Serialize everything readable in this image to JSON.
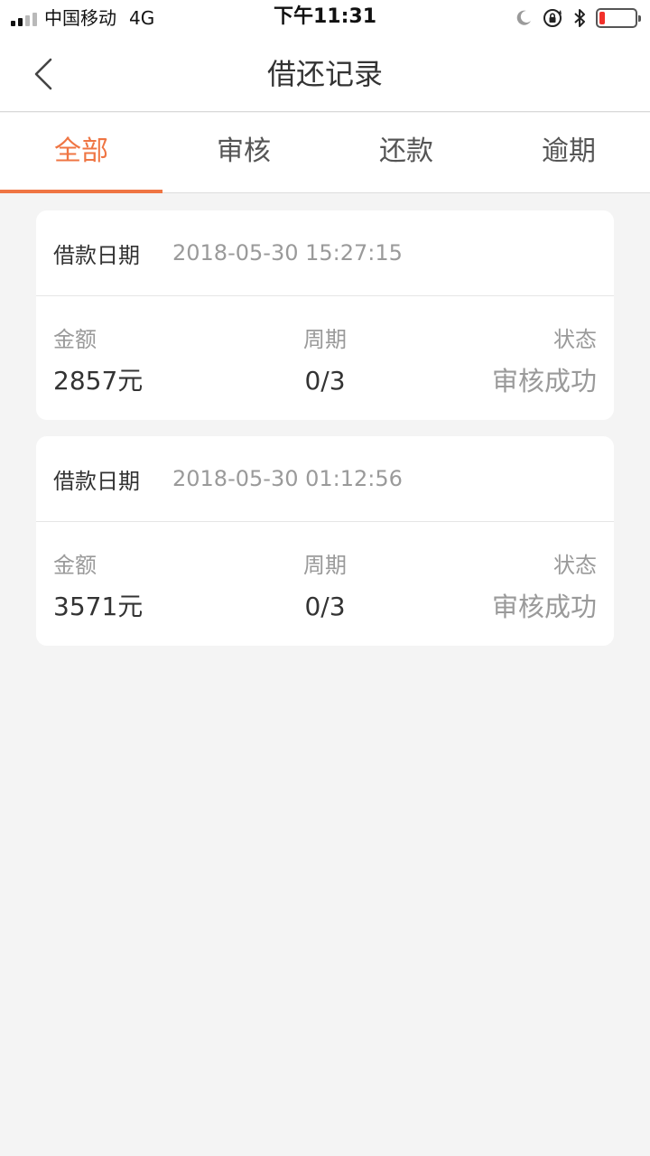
{
  "status_bar": {
    "carrier": "中国移动",
    "network": "4G",
    "time": "下午11:31",
    "battery_level": 0.15,
    "battery_color": "#f2312b"
  },
  "nav": {
    "title": "借还记录",
    "back_icon": "chevron-left-icon"
  },
  "tabs": [
    {
      "label": "全部",
      "active": true
    },
    {
      "label": "审核",
      "active": false
    },
    {
      "label": "还款",
      "active": false
    },
    {
      "label": "逾期",
      "active": false
    }
  ],
  "accent_color": "#ef7543",
  "records": [
    {
      "date_label": "借款日期",
      "date": "2018-05-30 15:27:15",
      "amount_label": "金额",
      "amount": "2857元",
      "period_label": "周期",
      "period": "0/3",
      "status_label": "状态",
      "status": "审核成功"
    },
    {
      "date_label": "借款日期",
      "date": "2018-05-30 01:12:56",
      "amount_label": "金额",
      "amount": "3571元",
      "period_label": "周期",
      "period": "0/3",
      "status_label": "状态",
      "status": "审核成功"
    }
  ]
}
